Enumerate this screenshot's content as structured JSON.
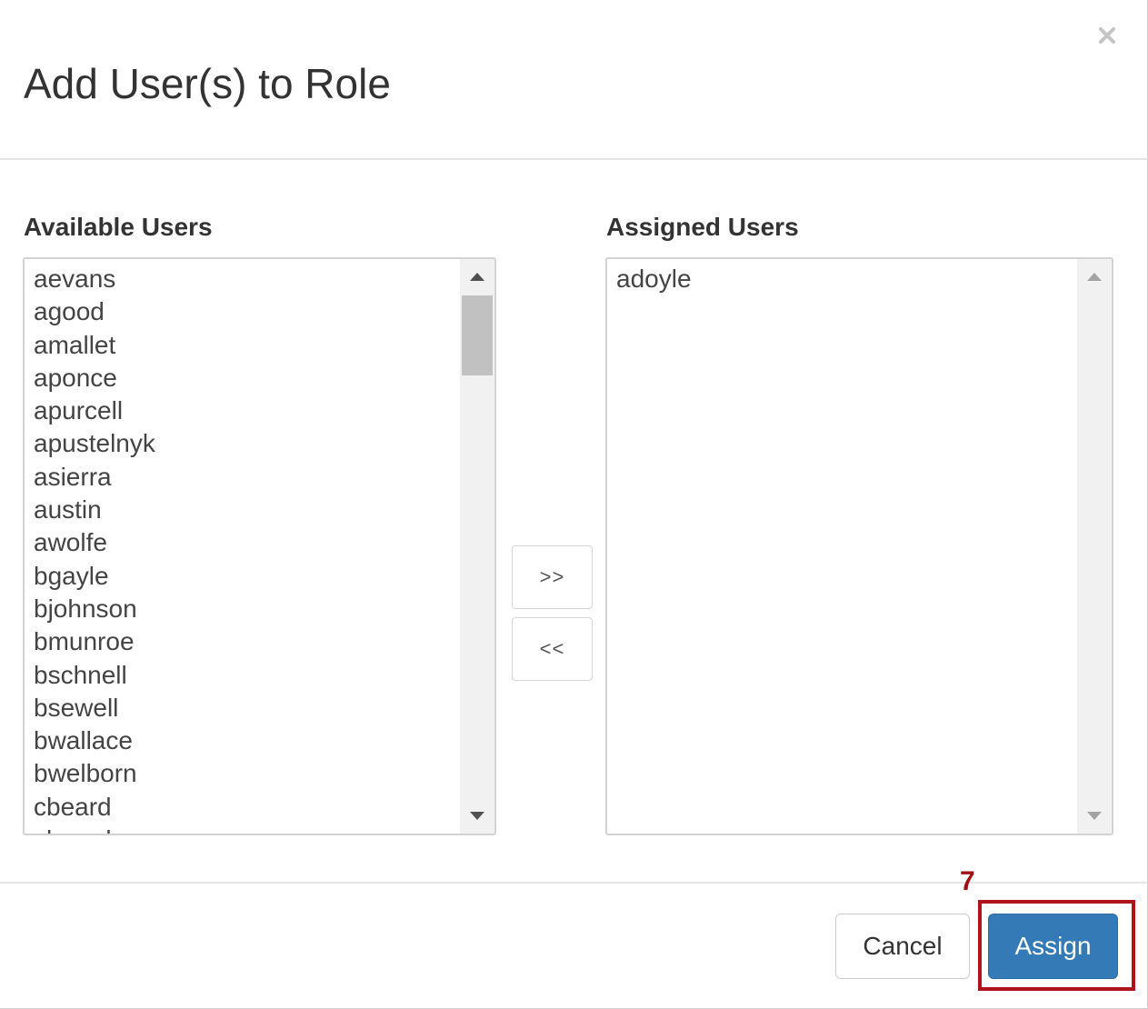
{
  "dialog": {
    "title": "Add User(s) to Role",
    "close_icon": "close-icon"
  },
  "available": {
    "label": "Available Users",
    "users": [
      "aevans",
      "agood",
      "amallet",
      "aponce",
      "apurcell",
      "apustelnyk",
      "asierra",
      "austin",
      "awolfe",
      "bgayle",
      "bjohnson",
      "bmunroe",
      "bschnell",
      "bsewell",
      "bwallace",
      "bwelborn",
      "cbeard",
      "cbeard"
    ]
  },
  "assigned": {
    "label": "Assigned Users",
    "users": [
      "adoyle"
    ]
  },
  "transfer": {
    "add_label": ">>",
    "remove_label": "<<"
  },
  "footer": {
    "cancel_label": "Cancel",
    "assign_label": "Assign"
  },
  "annotation": {
    "step_number": "7",
    "color": "#b0141b"
  },
  "colors": {
    "primary": "#337ab7",
    "text": "#333333"
  }
}
